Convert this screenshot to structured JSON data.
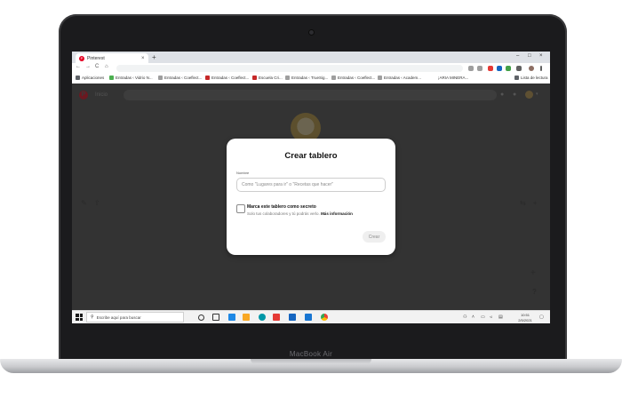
{
  "device": {
    "model_label": "MacBook Air"
  },
  "browser": {
    "tab_title": "Pinterest",
    "tab_close": "×",
    "new_tab": "+",
    "window_controls": [
      "–",
      "□",
      "×"
    ],
    "nav": {
      "back": "←",
      "forward": "→",
      "reload": "C",
      "home": "⌂"
    },
    "bookmarks": [
      {
        "label": "Aplicaciones",
        "color": "#5f6368"
      },
      {
        "label": "Entradas ‹ Vidrio N...",
        "color": "#4caf50"
      },
      {
        "label": "Entradas ‹ Coeflect...",
        "color": "#9e9e9e"
      },
      {
        "label": "Entradas ‹ Coeflect...",
        "color": "#c62828"
      },
      {
        "label": "Escuela Cri...",
        "color": "#c62828"
      },
      {
        "label": "Entradas ‹ TrueSig...",
        "color": "#9e9e9e"
      },
      {
        "label": "Entradas ‹ Coeflect...",
        "color": "#9e9e9e"
      },
      {
        "label": "Entradas ‹ Academ...",
        "color": "#9e9e9e"
      },
      {
        "label": "¡ARIA MINERA...",
        "color": "#9e9e9e"
      },
      {
        "label": "Lista de lectura",
        "color": "#5f6368"
      }
    ]
  },
  "pinterest": {
    "logo": "P",
    "home_label": "Inicio",
    "brand_color": "#e60023"
  },
  "modal": {
    "title": "Crear tablero",
    "name_label": "Nombre",
    "name_placeholder": "Como \"Lugares para ir\" o \"Recetas que hacer\"",
    "name_value": "",
    "secret_checked": false,
    "secret_title": "Marca este tablero como secreto",
    "secret_desc": "Solo tus colaboradores y tú podrás verlo.",
    "more_info": "Más información",
    "create_label": "Crear"
  },
  "taskbar": {
    "search_placeholder": "Escribe aquí para buscar",
    "time": "10:51",
    "date": "2/5/2021"
  }
}
